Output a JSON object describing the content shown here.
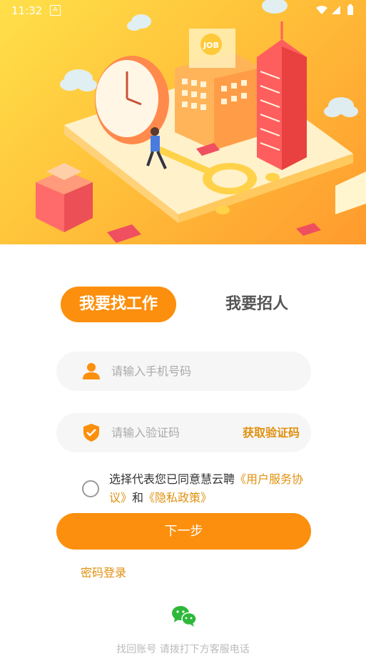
{
  "status_bar": {
    "time": "11:32",
    "notification_icon": "A"
  },
  "hero": {
    "badge_text": "JOB"
  },
  "tabs": {
    "job_seeker": "我要找工作",
    "recruiter": "我要招人"
  },
  "phone_field": {
    "placeholder": "请输入手机号码",
    "icon": "person-icon"
  },
  "code_field": {
    "placeholder": "请输入验证码",
    "icon": "shield-icon",
    "get_code_label": "获取验证码"
  },
  "agreement": {
    "prefix": "选择代表您已同意慧云聘",
    "user_agreement": "《用户服务协议》",
    "and": "和",
    "privacy_policy": "《隐私政策》"
  },
  "next_button": "下一步",
  "password_login": "密码登录",
  "bottom_hint": "找回账号 请拨打下方客服电话",
  "colors": {
    "accent": "#fc8f0d",
    "link": "#e0900f",
    "field_bg": "#f6f6f6"
  }
}
